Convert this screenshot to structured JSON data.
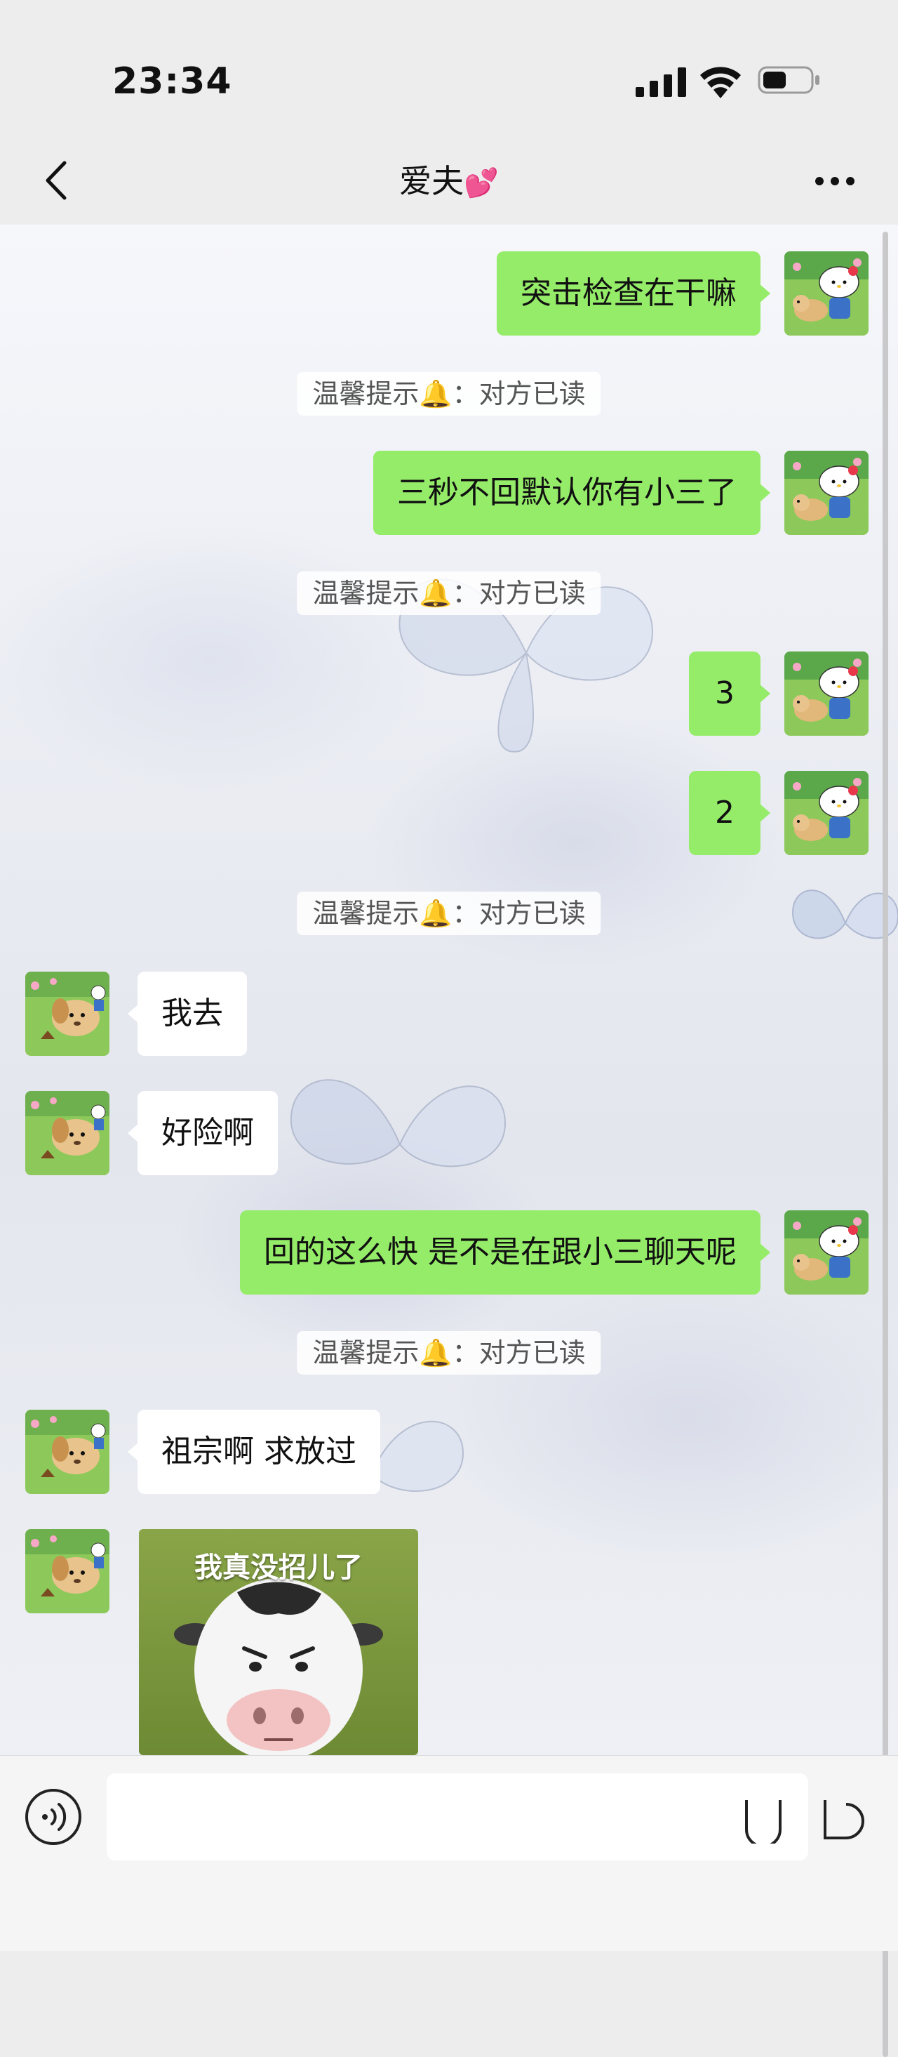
{
  "status_bar": {
    "time": "23:34"
  },
  "header": {
    "title": "爱夫",
    "title_emoji": "💕"
  },
  "messages": [
    {
      "from": "me",
      "text": "突击检查在干嘛"
    },
    {
      "type": "notice",
      "text": "温馨提示🔔：对方已读"
    },
    {
      "from": "me",
      "text": "三秒不回默认你有小三了"
    },
    {
      "type": "notice",
      "text": "温馨提示🔔：对方已读"
    },
    {
      "from": "me",
      "text": "3"
    },
    {
      "from": "me",
      "text": "2"
    },
    {
      "type": "notice",
      "text": "温馨提示🔔：对方已读"
    },
    {
      "from": "other",
      "text": "我去"
    },
    {
      "from": "other",
      "text": "好险啊"
    },
    {
      "from": "me",
      "text": "回的这么快 是不是在跟小三聊天呢"
    },
    {
      "type": "notice",
      "text": "温馨提示🔔：对方已读"
    },
    {
      "from": "other",
      "text": "祖宗啊 求放过"
    },
    {
      "from": "other",
      "type": "sticker",
      "text": "我真没招儿了"
    }
  ],
  "input": {
    "value": "",
    "placeholder": ""
  },
  "icons": {
    "back": "chevron-left-icon",
    "more": "more-dots-icon",
    "voice": "voice-icon",
    "signal": "cellular-signal-icon",
    "wifi": "wifi-icon",
    "battery": "battery-icon"
  },
  "colors": {
    "my_bubble": "#95ec69",
    "other_bubble": "#ffffff",
    "background": "#ededed"
  }
}
